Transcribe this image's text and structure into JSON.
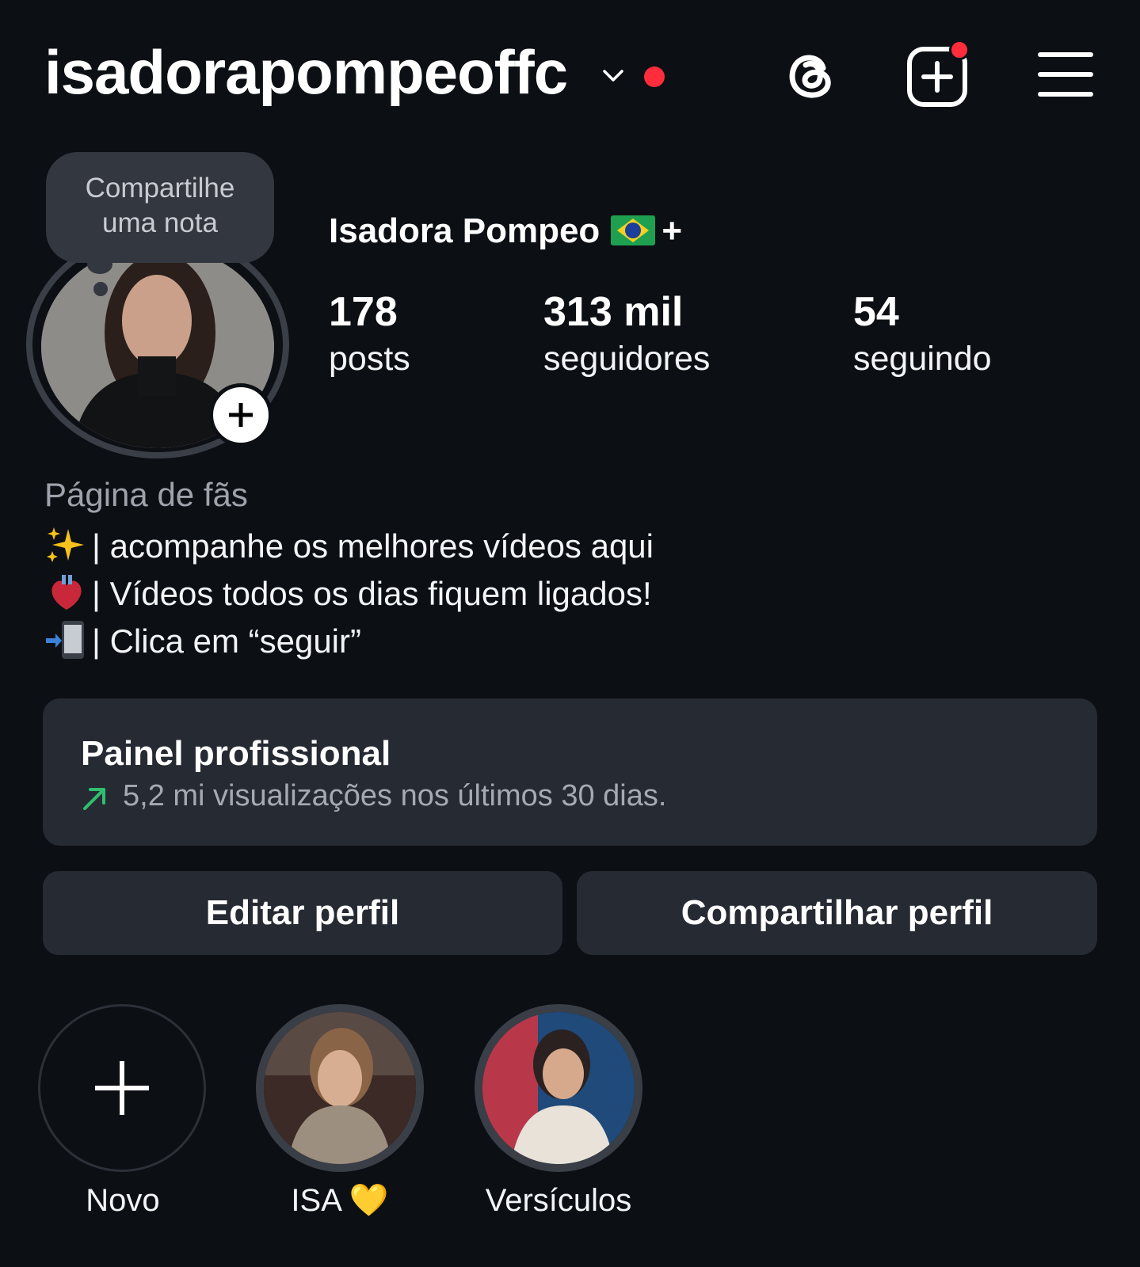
{
  "header": {
    "username": "isadorapompeoffc",
    "icons": [
      "chevron-down-icon",
      "threads-icon",
      "new-post-icon",
      "menu-icon"
    ]
  },
  "note": {
    "line1": "Compartilhe",
    "line2": "uma nota"
  },
  "profile": {
    "display_name": "Isadora Pompeo",
    "name_suffix": "+",
    "flag_emoji": "brazil-flag"
  },
  "stats": [
    {
      "value": "178",
      "label": "posts"
    },
    {
      "value": "313 mil",
      "label": "seguidores"
    },
    {
      "value": "54",
      "label": "seguindo"
    }
  ],
  "bio": {
    "category": "Página de fãs",
    "lines": [
      {
        "emoji": "sparkles",
        "text": "| acompanhe os melhores vídeos aqui"
      },
      {
        "emoji": "anatomical-heart",
        "text": "| Vídeos todos os dias fiquem ligados!"
      },
      {
        "emoji": "mobile-phone-arrow",
        "text": "| Clica em “seguir”"
      }
    ]
  },
  "dashboard": {
    "title": "Painel profissional",
    "subtitle": "5,2 mi visualizações nos últimos 30 dias."
  },
  "buttons": {
    "edit": "Editar perfil",
    "share": "Compartilhar perfil"
  },
  "highlights": [
    {
      "label": "Novo"
    },
    {
      "label": "ISA 💛"
    },
    {
      "label": "Versículos"
    }
  ],
  "colors": {
    "background": "#0c0f14",
    "card": "#262a33",
    "notification": "#ff2d3c",
    "trend_up": "#2fbf71"
  }
}
